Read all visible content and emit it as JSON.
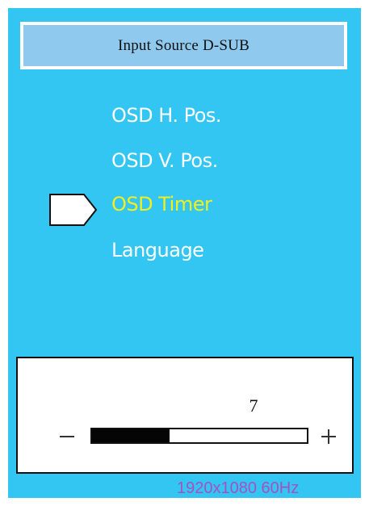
{
  "header": {
    "title": "Input Source D-SUB"
  },
  "menu": {
    "items": [
      {
        "label": "OSD H. Pos.",
        "selected": false
      },
      {
        "label": "OSD V. Pos.",
        "selected": false
      },
      {
        "label": "OSD Timer",
        "selected": true
      },
      {
        "label": "Language",
        "selected": false
      }
    ],
    "selected_pointer_icon": "pointer-arrow-icon"
  },
  "adjustment": {
    "value": "7",
    "minus_icon": "minus-icon",
    "plus_icon": "plus-icon",
    "level_fraction": 0.36
  },
  "status": {
    "resolution": "1920x1080 60Hz"
  },
  "colors": {
    "panel_bg": "#33c6f2",
    "header_bg": "#8fc9ee",
    "menu_text": "#ffffff",
    "selected_text": "#f3ef1c",
    "resolution_text": "#a94fc0",
    "slider_fill": "#050505"
  }
}
